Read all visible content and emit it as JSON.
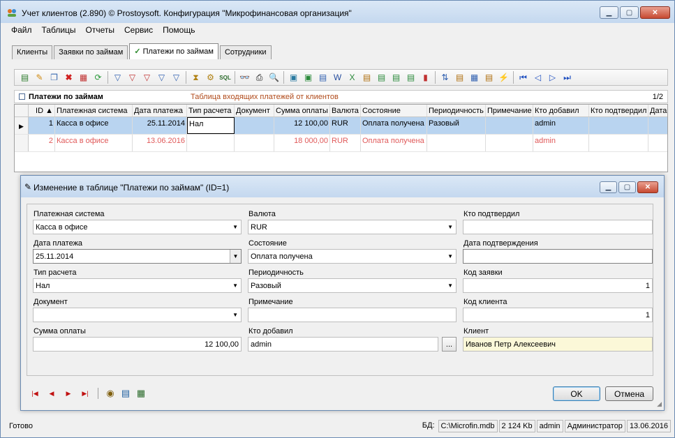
{
  "window": {
    "title": "Учет клиентов (2.890) © Prostoysoft. Конфигурация \"Микрофинансовая организация\""
  },
  "menu": [
    "Файл",
    "Таблицы",
    "Отчеты",
    "Сервис",
    "Помощь"
  ],
  "tabs": [
    {
      "label": "Клиенты",
      "active": false
    },
    {
      "label": "Заявки по займам",
      "active": false
    },
    {
      "label": "Платежи по займам",
      "active": true
    },
    {
      "label": "Сотрудники",
      "active": false
    }
  ],
  "grid": {
    "title": "Платежи по займам",
    "description": "Таблица входящих платежей от клиентов",
    "page": "1/2",
    "columns": [
      "ID",
      "Платежная система",
      "Дата платежа",
      "Тип расчета",
      "Документ",
      "Сумма оплаты",
      "Валюта",
      "Состояние",
      "Периодичность",
      "Примечание",
      "Кто добавил",
      "Кто подтвердил",
      "Дата"
    ],
    "rows": [
      {
        "id": "1",
        "system": "Касса в офисе",
        "date": "25.11.2014",
        "type": "Нал",
        "doc": "",
        "sum": "12 100,00",
        "cur": "RUR",
        "state": "Оплата получена",
        "period": "Разовый",
        "note": "",
        "added": "admin",
        "confirmed": "",
        "dt": ""
      },
      {
        "id": "2",
        "system": "Касса в офисе",
        "date": "13.06.2016",
        "type": "",
        "doc": "",
        "sum": "18 000,00",
        "cur": "RUR",
        "state": "Оплата получена",
        "period": "",
        "note": "",
        "added": "admin",
        "confirmed": "",
        "dt": ""
      }
    ]
  },
  "dialog": {
    "title": "Изменение в таблице \"Платежи по займам\" (ID=1)",
    "fields": {
      "payment_system": {
        "label": "Платежная система",
        "value": "Касса в офисе"
      },
      "payment_date": {
        "label": "Дата платежа",
        "value": "25.11.2014"
      },
      "calc_type": {
        "label": "Тип расчета",
        "value": "Нал"
      },
      "document": {
        "label": "Документ",
        "value": ""
      },
      "amount": {
        "label": "Сумма оплаты",
        "value": "12 100,00"
      },
      "currency": {
        "label": "Валюта",
        "value": "RUR"
      },
      "state": {
        "label": "Состояние",
        "value": "Оплата получена"
      },
      "periodicity": {
        "label": "Периодичность",
        "value": "Разовый"
      },
      "note": {
        "label": "Примечание",
        "value": ""
      },
      "added_by": {
        "label": "Кто добавил",
        "value": "admin"
      },
      "confirmed_by": {
        "label": "Кто подтвердил",
        "value": ""
      },
      "confirm_date": {
        "label": "Дата подтверждения",
        "value": ""
      },
      "request_code": {
        "label": "Код заявки",
        "value": "1"
      },
      "client_code": {
        "label": "Код клиента",
        "value": "1"
      },
      "client": {
        "label": "Клиент",
        "value": "Иванов Петр Алексеевич"
      }
    },
    "ellipsis": "...",
    "ok": "OK",
    "cancel": "Отмена"
  },
  "status": {
    "text": "Готово",
    "db_label": "БД:",
    "db_path": "C:\\Microfin.mdb",
    "size": "2 124 Kb",
    "user": "admin",
    "role": "Администратор",
    "date": "13.06.2016"
  }
}
